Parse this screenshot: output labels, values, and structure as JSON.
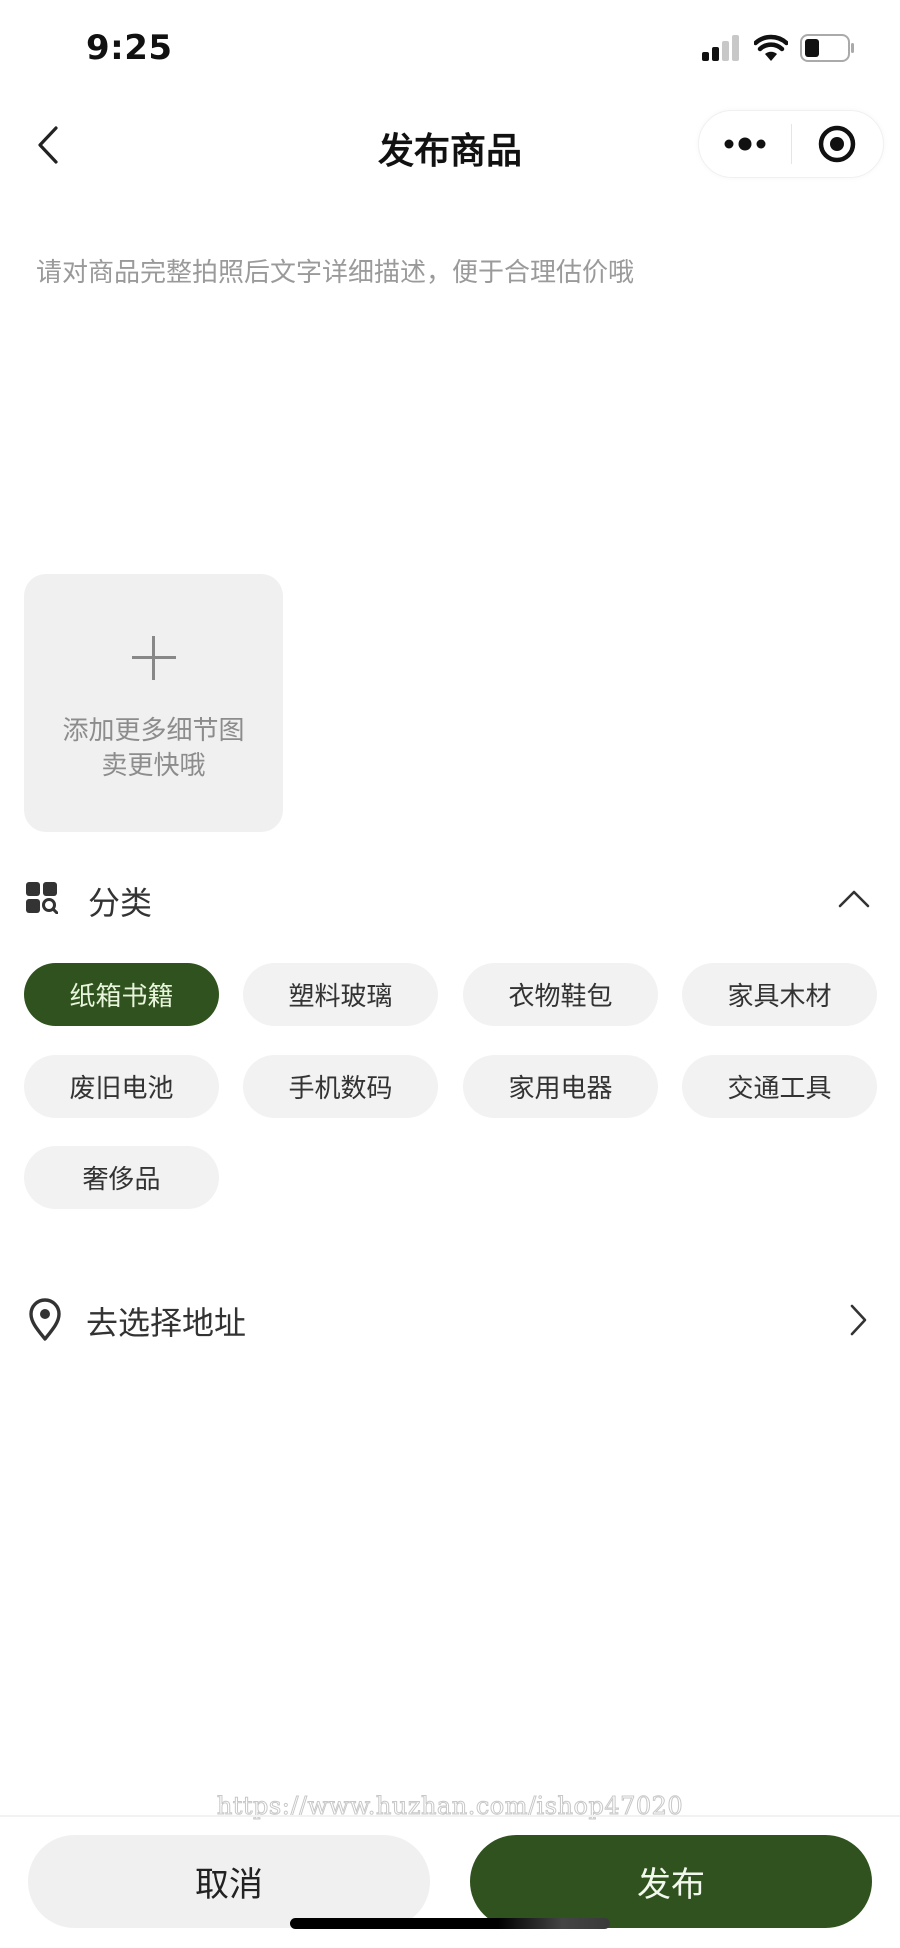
{
  "status_bar": {
    "time": "9:25",
    "icons": [
      "signal-icon",
      "wifi-icon",
      "battery-icon"
    ]
  },
  "nav": {
    "title": "发布商品",
    "back_icon": "chevron-left-icon",
    "more_icon": "more-dots-icon",
    "close_icon": "target-circle-icon"
  },
  "description": {
    "value": "",
    "placeholder": "请对商品完整拍照后文字详细描述，便于合理估价哦"
  },
  "upload": {
    "icon": "plus-icon",
    "line1": "添加更多细节图",
    "line2": "卖更快哦"
  },
  "category": {
    "icon": "category-search-icon",
    "title": "分类",
    "collapse_icon": "chevron-up-icon",
    "selected": "纸箱书籍",
    "items": [
      {
        "label": "纸箱书籍",
        "selected": true
      },
      {
        "label": "塑料玻璃",
        "selected": false
      },
      {
        "label": "衣物鞋包",
        "selected": false
      },
      {
        "label": "家具木材",
        "selected": false
      },
      {
        "label": "废旧电池",
        "selected": false
      },
      {
        "label": "手机数码",
        "selected": false
      },
      {
        "label": "家用电器",
        "selected": false
      },
      {
        "label": "交通工具",
        "selected": false
      },
      {
        "label": "奢侈品",
        "selected": false
      }
    ]
  },
  "address": {
    "icon": "location-pin-icon",
    "label": "去选择地址",
    "chevron_icon": "chevron-right-icon"
  },
  "watermark": "https://www.huzhan.com/ishop47020",
  "actions": {
    "cancel": "取消",
    "publish": "发布"
  },
  "colors": {
    "accent": "#2f521e",
    "chip_bg": "#f2f2f2",
    "placeholder": "#9a9a9a"
  }
}
